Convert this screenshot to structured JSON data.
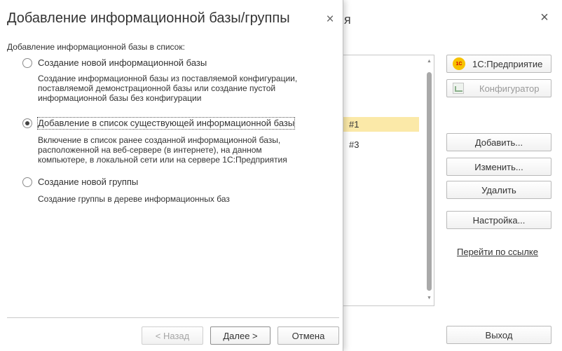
{
  "background_window": {
    "title_fragment": "я",
    "close_glyph": "×",
    "list": {
      "rows": [
        {
          "text": "#1",
          "selected": true
        },
        {
          "text": "#3",
          "selected": false
        }
      ],
      "scroll_up": "▲",
      "scroll_down": "▼"
    },
    "buttons": {
      "enterprise": "1С:Предприятие",
      "enterprise_icon_text": "1C",
      "configurator": "Конфигуратор",
      "add": "Добавить...",
      "edit": "Изменить...",
      "delete": "Удалить",
      "settings": "Настройка...",
      "exit": "Выход"
    },
    "link": "Перейти по ссылке"
  },
  "dialog": {
    "title": "Добавление информационной базы/группы",
    "close_glyph": "×",
    "intro": "Добавление информационной базы в список:",
    "options": [
      {
        "label": "Создание новой информационной базы",
        "checked": false,
        "description": [
          "Создание информационной базы из поставляемой конфигурации,",
          "поставляемой демонстрационной базы или создание пустой",
          "информационной базы без конфигурации"
        ]
      },
      {
        "label": "Добавление в список существующей информационной базы",
        "checked": true,
        "description": [
          "Включение в список ранее созданной информационной базы,",
          "расположенной на веб-сервере (в интернете), на данном",
          "компьютере,  в локальной сети или на сервере 1С:Предприятия"
        ]
      },
      {
        "label": "Создание новой группы",
        "checked": false,
        "description": [
          "Создание группы в дереве информационных баз"
        ]
      }
    ],
    "buttons": {
      "back": "< Назад",
      "next": "Далее >",
      "cancel": "Отмена"
    }
  }
}
